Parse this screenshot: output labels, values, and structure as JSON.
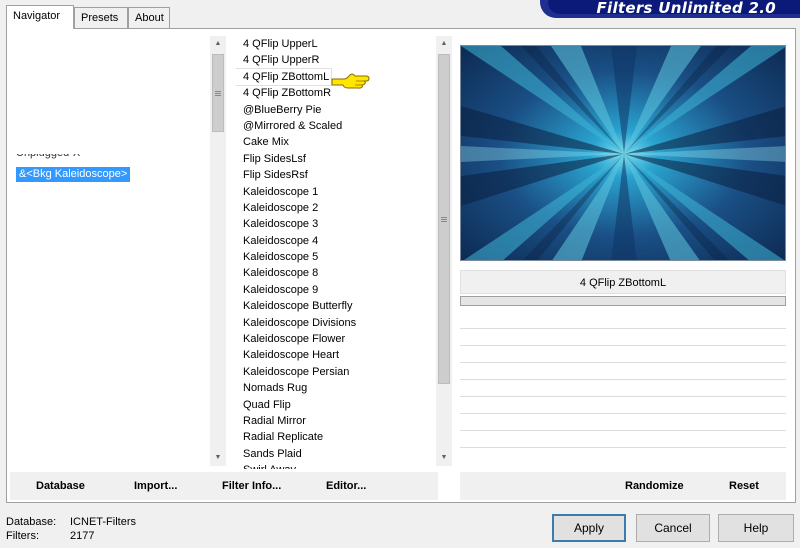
{
  "tabs": [
    {
      "label": "Navigator"
    },
    {
      "label": "Presets"
    },
    {
      "label": "About"
    }
  ],
  "header": {
    "title": "Filters Unlimited 2.0"
  },
  "navigator": {
    "selected": "&<Bkg Kaleidoscope>"
  },
  "filters": [
    "4 QFlip UpperL",
    "4 QFlip UpperR",
    "4 QFlip ZBottomL",
    "4 QFlip ZBottomR",
    "@BlueBerry Pie",
    "@Mirrored & Scaled",
    "Cake Mix",
    "Flip SidesLsf",
    "Flip SidesRsf",
    "Kaleidoscope 1",
    "Kaleidoscope 2",
    "Kaleidoscope 3",
    "Kaleidoscope 4",
    "Kaleidoscope 5",
    "Kaleidoscope 8",
    "Kaleidoscope 9",
    "Kaleidoscope Butterfly",
    "Kaleidoscope Divisions",
    "Kaleidoscope Flower",
    "Kaleidoscope Heart",
    "Kaleidoscope Persian",
    "Nomads Rug",
    "Quad Flip",
    "Radial Mirror",
    "Radial Replicate",
    "Sands Plaid",
    "Swirl Away"
  ],
  "selected_filter_index": 2,
  "preview": {
    "filter_name": "4 QFlip ZBottomL"
  },
  "left_actions": {
    "database": "Database",
    "import": "Import...",
    "filter_info": "Filter Info...",
    "editor": "Editor..."
  },
  "right_actions": {
    "randomize": "Randomize",
    "reset": "Reset"
  },
  "status": {
    "database_label": "Database:",
    "database_value": "ICNET-Filters",
    "filters_label": "Filters:",
    "filters_value": "2177"
  },
  "buttons": {
    "apply": "Apply",
    "cancel": "Cancel",
    "help": "Help"
  },
  "colors": {
    "selection": "#3399ff",
    "header_bg": "#0b1a78",
    "preview_center": "#3fb7d8",
    "preview_dark": "#0d2a52"
  },
  "icons": {
    "pointer": "pointing-hand-icon",
    "scroll_up": "scroll-up-arrow-icon",
    "scroll_down": "scroll-down-arrow-icon"
  }
}
